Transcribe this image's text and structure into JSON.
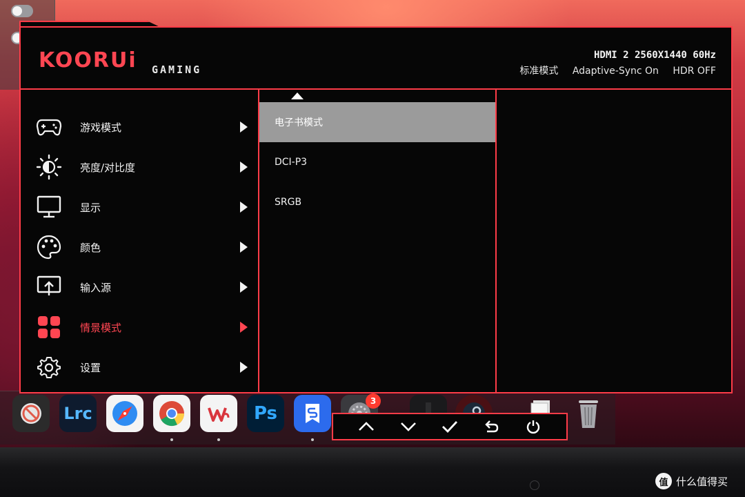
{
  "header": {
    "logo": "KOORUi",
    "subtitle": "GAMING",
    "signal": "HDMI 2 2560X1440 60Hz",
    "mode": "标准模式",
    "sync": "Adaptive-Sync On",
    "hdr": "HDR OFF"
  },
  "menu": {
    "items": [
      {
        "label": "游戏模式",
        "icon": "gamepad-icon"
      },
      {
        "label": "亮度/对比度",
        "icon": "brightness-icon"
      },
      {
        "label": "显示",
        "icon": "monitor-icon"
      },
      {
        "label": "颜色",
        "icon": "palette-icon"
      },
      {
        "label": "输入源",
        "icon": "input-source-icon"
      },
      {
        "label": "情景模式",
        "icon": "scene-mode-icon",
        "active": true
      },
      {
        "label": "设置",
        "icon": "gear-icon"
      }
    ]
  },
  "submenu": {
    "items": [
      {
        "label": "电子书模式",
        "selected": true
      },
      {
        "label": "DCI-P3"
      },
      {
        "label": "SRGB"
      }
    ]
  },
  "controls": [
    "up-icon",
    "down-icon",
    "check-icon",
    "back-icon",
    "power-icon"
  ],
  "dock": {
    "lrc_label": "Lrc",
    "ps_label": "Ps",
    "badge_count": "3"
  },
  "watermark": {
    "logo": "值",
    "text": "什么值得买"
  },
  "colors": {
    "accent": "#ff3c48",
    "osd_bg": "#060606",
    "selected_bg": "#9b9b9b"
  }
}
